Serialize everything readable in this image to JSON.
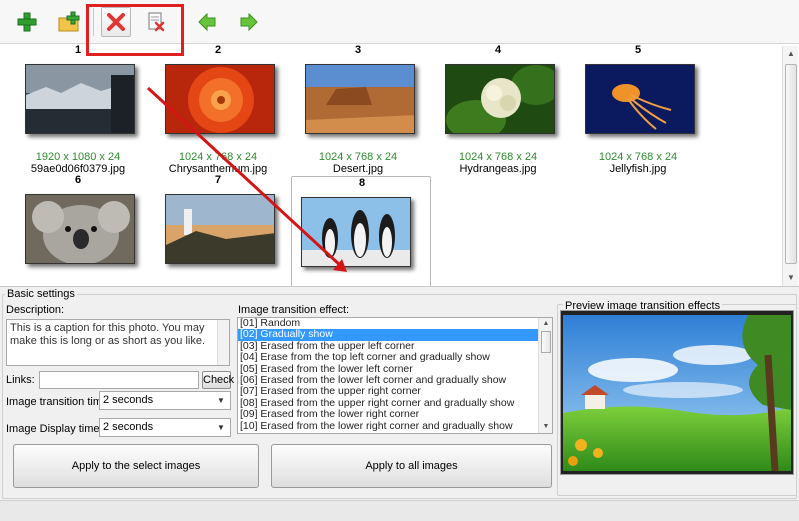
{
  "toolbar": {
    "buttons": [
      {
        "name": "add-images",
        "icon": "plus-icon"
      },
      {
        "name": "add-folder",
        "icon": "folder-add-icon"
      },
      {
        "name": "delete",
        "icon": "delete-x-icon"
      },
      {
        "name": "delete-all",
        "icon": "delete-page-icon"
      },
      {
        "name": "move-left",
        "icon": "arrow-left-icon"
      },
      {
        "name": "move-right",
        "icon": "arrow-right-icon"
      }
    ]
  },
  "gallery": {
    "thumbs": [
      {
        "num": "1",
        "size": "1920 x 1080 x 24",
        "name": "59ae0d06f0379.jpg"
      },
      {
        "num": "2",
        "size": "1024 x 768 x 24",
        "name": "Chrysanthemum.jpg"
      },
      {
        "num": "3",
        "size": "1024 x 768 x 24",
        "name": "Desert.jpg"
      },
      {
        "num": "4",
        "size": "1024 x 768 x 24",
        "name": "Hydrangeas.jpg"
      },
      {
        "num": "5",
        "size": "1024 x 768 x 24",
        "name": "Jellyfish.jpg"
      },
      {
        "num": "6",
        "size": "",
        "name": ""
      },
      {
        "num": "7",
        "size": "",
        "name": ""
      },
      {
        "num": "8",
        "size": "",
        "name": ""
      }
    ]
  },
  "settings": {
    "group_title": "Basic settings",
    "description_label": "Description:",
    "description_value": "This is a caption for this photo. You may make this is long or as short as you like.",
    "links_label": "Links:",
    "links_value": "",
    "check_button": "Check",
    "transition_time_label": "Image transition time:",
    "transition_time_value": "2 seconds",
    "display_time_label": "Image Display time:",
    "display_time_value": "2 seconds",
    "effect_label": "Image transition effect:",
    "effects": [
      "[01] Random",
      "[02] Gradually show",
      "[03] Erased from the upper left corner",
      "[04] Erase from the top left corner and gradually show",
      "[05] Erased from the lower left corner",
      "[06] Erased from the lower left corner and gradually show",
      "[07] Erased from the upper right corner",
      "[08] Erased from the upper right corner and gradually show",
      "[09] Erased from the lower right corner",
      "[10] Erased from the lower right corner and gradually show"
    ],
    "selected_effect_index": 1,
    "apply_selected_button": "Apply to the select images",
    "apply_all_button": "Apply to all images",
    "preview_title": "Preview image transition effects"
  },
  "colors": {
    "highlight_box": "#e01f1f",
    "annotation_arrow": "#d41515",
    "size_text": "#2e8b2e",
    "list_selection": "#3399ff"
  }
}
